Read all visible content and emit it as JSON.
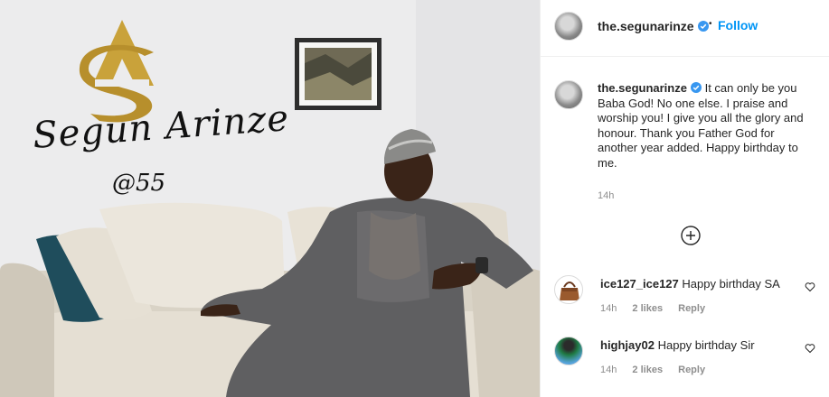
{
  "post": {
    "image": {
      "logo_initials": "SA",
      "logo_name": "Segun Arinze",
      "logo_age": "@55",
      "colors": {
        "gold": "#c9a23a",
        "wall": "#ececed",
        "sofa": "#ddd6c9",
        "agbada": "#5f5f61"
      }
    },
    "header": {
      "username": "the.segunarinze",
      "separator": "•",
      "follow_label": "Follow",
      "follow_color": "#0095f6"
    },
    "caption": {
      "username": "the.segunarinze",
      "text": "It can only be you Baba God! No one else. I praise and worship you! I give you all the glory and honour. Thank you Father God for another year added. Happy birthday to me.",
      "time": "14h"
    },
    "load_more_icon": "plus-circle-icon",
    "comments": [
      {
        "username": "ice127_ice127",
        "text": "Happy birthday SA",
        "time": "14h",
        "likes": "2 likes",
        "reply": "Reply"
      },
      {
        "username": "highjay02",
        "text": "Happy birthday Sir",
        "time": "14h",
        "likes": "2 likes",
        "reply": "Reply"
      }
    ]
  }
}
